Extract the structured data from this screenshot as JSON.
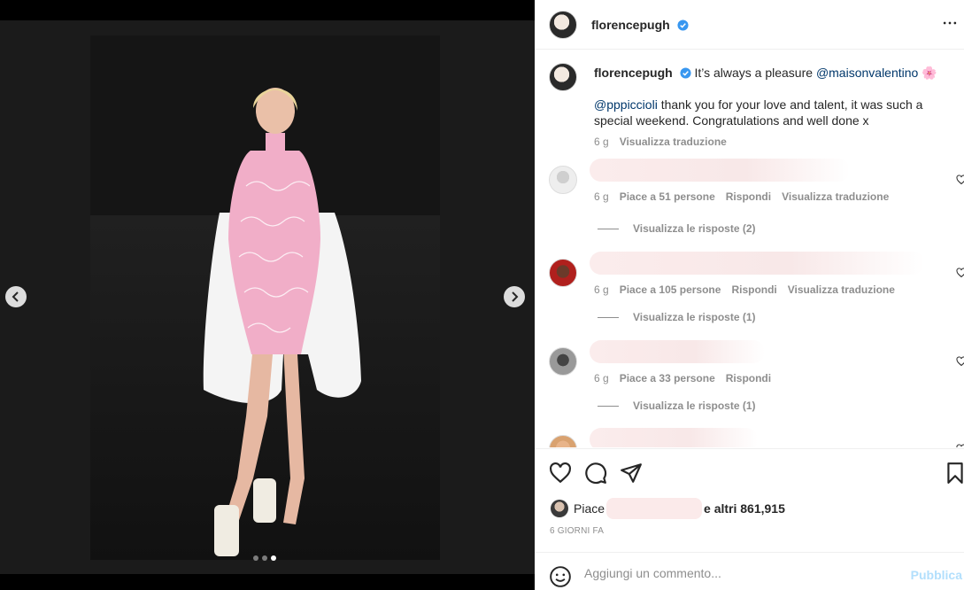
{
  "post": {
    "username": "florencepugh",
    "verified": true,
    "caption_text_1": "It’s always a pleasure ",
    "caption_mention_1": "@maisonvalentino",
    "caption_emoji": "🌸",
    "caption_mention_2": "@pppiccioli",
    "caption_text_2": " thank you for your love and talent, it was such a special weekend. Congratulations and well done x",
    "caption_age": "6 g",
    "caption_translate": "Visualizza traduzione"
  },
  "comments": [
    {
      "age": "6 g",
      "likes": "Piace a 51 persone",
      "reply": "Rispondi",
      "translate": "Visualizza traduzione",
      "replies": "Visualizza le risposte (2)"
    },
    {
      "age": "6 g",
      "likes": "Piace a 105 persone",
      "reply": "Rispondi",
      "translate": "Visualizza traduzione",
      "replies": "Visualizza le risposte (1)"
    },
    {
      "age": "6 g",
      "likes": "Piace a 33 persone",
      "reply": "Rispondi",
      "translate": "",
      "replies": "Visualizza le risposte (1)"
    }
  ],
  "likes_line": {
    "prefix": "Piace",
    "suffix": "e altri 861,915"
  },
  "time_ago": "6 GIORNI FA",
  "add_comment": {
    "placeholder": "Aggiungi un commento...",
    "publish": "Pubblica"
  },
  "carousel": {
    "count": 3,
    "active": 3
  },
  "colors": {
    "link": "#00376b",
    "meta": "#8e8e8e",
    "publish": "#b2dffc",
    "verified": "#3897f0"
  }
}
